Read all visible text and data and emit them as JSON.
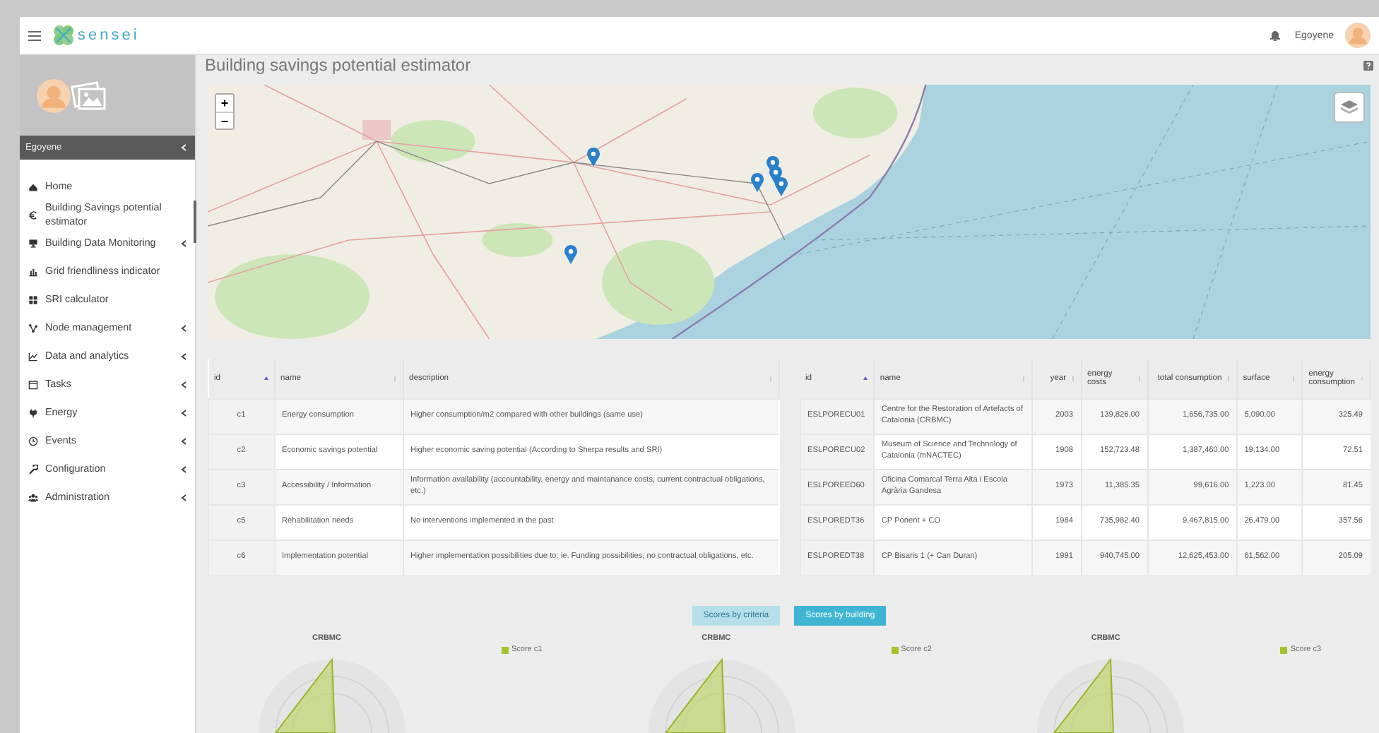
{
  "header": {
    "app_name": "sensei",
    "user": "Egoyene"
  },
  "sidebar": {
    "user": "Egoyene",
    "items": [
      {
        "label": "Home",
        "expandable": false
      },
      {
        "label": "Building Savings potential estimator",
        "expandable": false
      },
      {
        "label": "Building Data Monitoring",
        "expandable": true
      },
      {
        "label": "Grid friendliness indicator",
        "expandable": false
      },
      {
        "label": "SRI calculator",
        "expandable": false
      },
      {
        "label": "Node management",
        "expandable": true
      },
      {
        "label": "Data and analytics",
        "expandable": true
      },
      {
        "label": "Tasks",
        "expandable": true
      },
      {
        "label": "Energy",
        "expandable": true
      },
      {
        "label": "Events",
        "expandable": true
      },
      {
        "label": "Configuration",
        "expandable": true
      },
      {
        "label": "Administration",
        "expandable": true
      }
    ]
  },
  "page": {
    "title": "Building savings potential estimator"
  },
  "map": {
    "zoom_in": "+",
    "zoom_out": "−"
  },
  "criteria_table": {
    "columns": [
      {
        "label": "id",
        "sorted": true
      },
      {
        "label": "name",
        "sorted": false
      },
      {
        "label": "description",
        "sorted": false
      }
    ],
    "rows": [
      [
        "c1",
        "Energy consumption",
        "Higher consumption/m2 compared with other buildings (same use)"
      ],
      [
        "c2",
        "Economic savings potential",
        "Higher economic saving potential (According to Sherpa results and SRI)"
      ],
      [
        "c3",
        "Accessibility / Information",
        "Information availability (accountability, energy and maintanance costs, current contractual obligations, etc.)"
      ],
      [
        "c5",
        "Rehabilitation needs",
        "No interventions implemented in the past"
      ],
      [
        "c6",
        "Implementation potential",
        "Higher implementation possibilities due to: ie. Funding possibilities, no contractual obligations, etc."
      ]
    ]
  },
  "buildings_table": {
    "columns": [
      {
        "label": "id",
        "sorted": true
      },
      {
        "label": "name",
        "sorted": false
      },
      {
        "label": "year",
        "sorted": false
      },
      {
        "label": "energy costs",
        "sorted": false
      },
      {
        "label": "total consumption",
        "sorted": false
      },
      {
        "label": "surface",
        "sorted": false
      },
      {
        "label": "energy consumption",
        "sorted": false
      }
    ],
    "rows": [
      [
        "ESLPORECU01",
        "Centre for the Restoration of Artefacts of Catalonia (CRBMC)",
        "2003",
        "139,826.00",
        "1,656,735.00",
        "5,090.00",
        "325.49"
      ],
      [
        "ESLPORECU02",
        "Museum of Science and Technology of Catalonia (mNACTEC)",
        "1908",
        "152,723.48",
        "1,387,460.00",
        "19,134.00",
        "72.51"
      ],
      [
        "ESLPOREED60",
        "Oficina Comarcal Terra Alta i Escola Agrària Gandesa",
        "1973",
        "11,385.35",
        "99,616.00",
        "1,223.00",
        "81.45"
      ],
      [
        "ESLPOREDT36",
        "CP Ponent + CO",
        "1984",
        "735,982.40",
        "9,467,815.00",
        "26,479.00",
        "357.56"
      ],
      [
        "ESLPOREDT38",
        "CP Bisaris 1 (+ Can Duran)",
        "1991",
        "940,745.00",
        "12,625,453.00",
        "61,562.00",
        "205.09"
      ]
    ]
  },
  "view_buttons": [
    {
      "label": "Scores by criteria",
      "selected": false
    },
    {
      "label": "Scores by building",
      "selected": true
    }
  ],
  "radar_charts": [
    {
      "title": "CRBMC",
      "legend": "Score c1"
    },
    {
      "title": "CRBMC",
      "legend": "Score c2"
    },
    {
      "title": "CRBMC",
      "legend": "Score c3"
    }
  ]
}
